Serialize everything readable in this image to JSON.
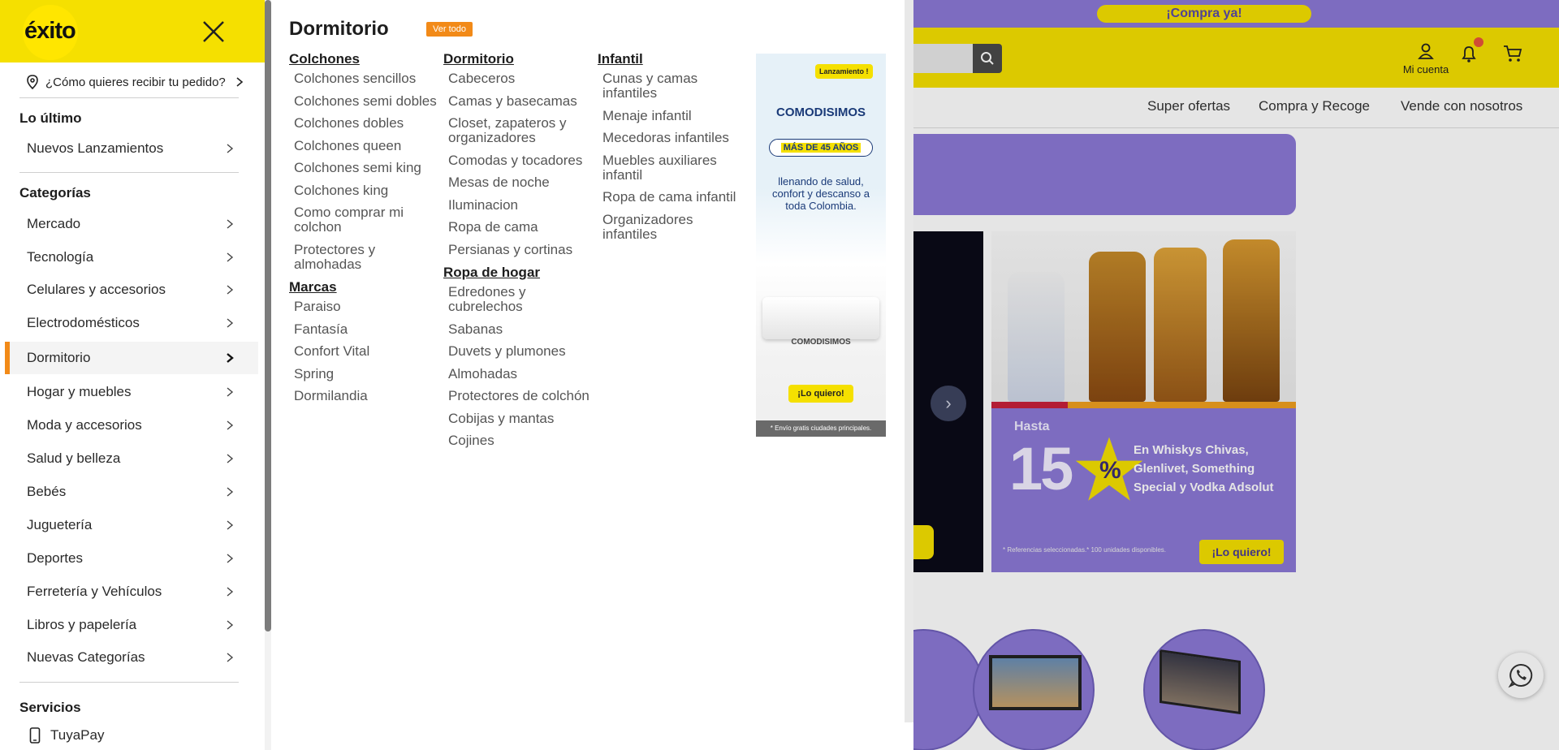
{
  "background": {
    "promo_label": "¡Compra ya!",
    "account_label": "Mi cuenta",
    "nav_items": [
      "Super ofertas",
      "Compra y Recoge",
      "Vende con nosotros"
    ],
    "liquor_banner": {
      "hasta": "Hasta",
      "discount_number": "15",
      "discount_symbol": "%",
      "text": "En Whiskys Chivas, Glenlivet, Something Special y Vodka Adsolut",
      "fine_print": "* Referencias seleccionadas.* 100 unidades disponibles.",
      "cta": "¡Lo quiero!"
    }
  },
  "sidebar": {
    "logo": "éxito",
    "deliver_prompt": "¿Cómo quieres recibir tu pedido?",
    "latest_title": "Lo último",
    "latest_items": [
      {
        "label": "Nuevos Lanzamientos"
      }
    ],
    "categories_title": "Categorías",
    "categories": [
      {
        "label": "Mercado"
      },
      {
        "label": "Tecnología"
      },
      {
        "label": "Celulares y accesorios"
      },
      {
        "label": "Electrodomésticos"
      },
      {
        "label": "Dormitorio",
        "active": true
      },
      {
        "label": "Hogar y muebles"
      },
      {
        "label": "Moda y accesorios"
      },
      {
        "label": "Salud y belleza"
      },
      {
        "label": "Bebés"
      },
      {
        "label": "Juguetería"
      },
      {
        "label": "Deportes"
      },
      {
        "label": "Ferretería y Vehículos"
      },
      {
        "label": "Libros y papelería"
      },
      {
        "label": "Nuevas Categorías"
      }
    ],
    "services_title": "Servicios",
    "services": [
      {
        "label": "TuyaPay"
      }
    ]
  },
  "mega": {
    "title": "Dormitorio",
    "view_all": "Ver todo",
    "columns": [
      {
        "groups": [
          {
            "title": "Colchones",
            "items": [
              "Colchones sencillos",
              "Colchones semi dobles",
              "Colchones dobles",
              "Colchones queen",
              "Colchones semi king",
              "Colchones king",
              "Como comprar mi colchon",
              "Protectores y almohadas"
            ]
          },
          {
            "title": "Marcas",
            "items": [
              "Paraiso",
              "Fantasía",
              "Confort Vital",
              "Spring",
              "Dormilandia"
            ]
          }
        ]
      },
      {
        "groups": [
          {
            "title": "Dormitorio",
            "items": [
              "Cabeceros",
              "Camas y basecamas",
              "Closet, zapateros y organizadores",
              "Comodas y tocadores",
              "Mesas de noche",
              "Iluminacion",
              "Ropa de cama",
              "Persianas y cortinas"
            ]
          },
          {
            "title": "Ropa de hogar",
            "items": [
              "Edredones y cubrelechos",
              "Sabanas",
              "Duvets y plumones",
              "Almohadas",
              "Protectores de colchón",
              "Cobijas y mantas",
              "Cojines"
            ]
          }
        ]
      },
      {
        "groups": [
          {
            "title": "Infantil",
            "items": [
              "Cunas y camas infantiles",
              "Menaje infantil",
              "Mecedoras infantiles",
              "Muebles auxiliares infantil",
              "Ropa de cama infantil",
              "Organizadores infantiles"
            ]
          }
        ]
      }
    ],
    "ad": {
      "badge": "Lanzamiento !",
      "brand": "COMODISIMOS",
      "years": "MÁS DE 45 AÑOS",
      "copy": "llenando de salud, confort y descanso a toda Colombia.",
      "brand_footer": "COMODISIMOS",
      "cta": "¡Lo quiero!",
      "footnote": "* Envío gratis ciudades principales."
    }
  },
  "colors": {
    "brand_yellow": "#f5e000",
    "accent_orange": "#f28a18",
    "promo_purple": "#8c79d6"
  }
}
